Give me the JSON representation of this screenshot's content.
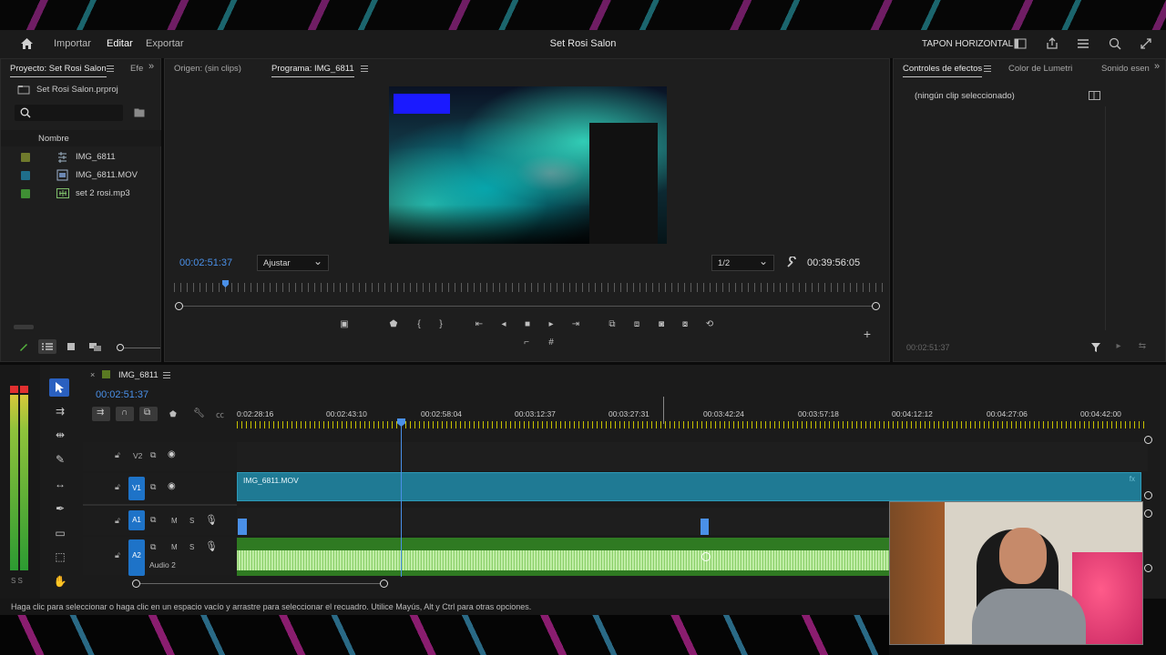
{
  "header": {
    "home_icon": "home-icon",
    "tabs": [
      "Importar",
      "Editar",
      "Exportar"
    ],
    "active_tab": "Editar",
    "project_title": "Set Rosi Salon",
    "workspace_label": "TAPON HORIZONTAL"
  },
  "project_panel": {
    "tab_project": "Proyecto: Set Rosi Salon",
    "tab_effects": "Efe",
    "project_file": "Set Rosi Salon.prproj",
    "column_name": "Nombre",
    "items": [
      {
        "name": "IMG_6811",
        "color": "#6f7a2c"
      },
      {
        "name": "IMG_6811.MOV",
        "color": "#1f6e8a"
      },
      {
        "name": "set 2 rosi.mp3",
        "color": "#3f8f34"
      }
    ]
  },
  "monitor": {
    "tab_source": "Origen: (sin clips)",
    "tab_program": "Programa: IMG_6811",
    "current_time": "00:02:51:37",
    "fit_label": "Ajustar",
    "resolution": "1/2",
    "duration": "00:39:56:05"
  },
  "effects_panel": {
    "tab_effect_controls": "Controles de efectos",
    "tab_lumetri": "Color de Lumetri",
    "tab_sound": "Sonido esen",
    "no_clip": "(ningún clip seleccionado)",
    "footer_time": "00:02:51:37"
  },
  "timeline": {
    "sequence_name": "IMG_6811",
    "current_time": "00:02:51:37",
    "ruler": [
      "0:02:28:16",
      "00:02:43:10",
      "00:02:58:04",
      "00:03:12:37",
      "00:03:27:31",
      "00:03:42:24",
      "00:03:57:18",
      "00:04:12:12",
      "00:04:27:06",
      "00:04:42:00"
    ],
    "tracks": {
      "v2": "V2",
      "v1": "V1",
      "a1": "A1",
      "a2": "A2",
      "a2_name": "Audio 2",
      "m": "M",
      "s": "S"
    },
    "video_clip": "IMG_6811.MOV",
    "meter_footer": "S S"
  },
  "status_bar": "Haga clic para seleccionar o haga clic en un espacio vacío y arrastre para seleccionar el recuadro. Utilice Mayús, Alt y Ctrl para otras opciones.",
  "colors": {
    "accent_blue": "#4a90e8",
    "video_clip": "#1f7a94",
    "audio_clip": "#3d8f2c",
    "audio_wave": "#a9df8a",
    "track_button": "#1e73c8"
  }
}
